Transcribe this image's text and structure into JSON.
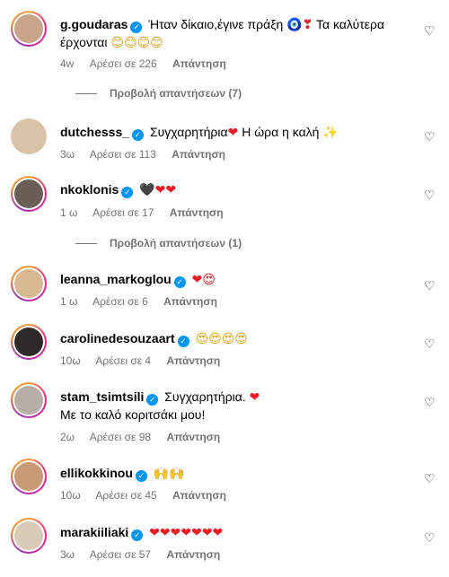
{
  "comments": [
    {
      "username": "g.goudaras",
      "text": "Ήταν δίκαιο,έγινε πράξη",
      "emojis_line1": "🧿❣",
      "text2": "Τα καλύτερα",
      "line2": "έρχονται",
      "emojis_line2": "😊😊😊😊",
      "time": "4w",
      "likes": "Αρέσει σε 226",
      "reply": "Απάντηση",
      "view_replies": "Προβολή απαντήσεων (7)",
      "avatar_color": "#c9a489",
      "ring": true
    },
    {
      "username": "dutchesss_",
      "text": "Συγχαρητήρια",
      "text_after": "Η ώρα η καλή",
      "emoji_mid": "❤",
      "emoji_end": "✨",
      "time": "3ω",
      "likes": "Αρέσει σε 113",
      "reply": "Απάντηση",
      "avatar_color": "#d8c2a8",
      "ring": false
    },
    {
      "username": "nkoklonis",
      "emojis": "🖤❤❤",
      "time": "1 ω",
      "likes": "Αρέσει σε 17",
      "reply": "Απάντηση",
      "view_replies": "Προβολή απαντήσεων (1)",
      "avatar_color": "#6b5e57",
      "ring": true
    },
    {
      "username": "leanna_markoglou",
      "emojis": "❤😍",
      "time": "1 ω",
      "likes": "Αρέσει σε 6",
      "reply": "Απάντηση",
      "avatar_color": "#d7b891",
      "ring": true
    },
    {
      "username": "carolinedesouzaart",
      "emojis": "😍😍😍😍",
      "time": "10ω",
      "likes": "Αρέσει σε 4",
      "reply": "Απάντηση",
      "avatar_color": "#2e2a28",
      "ring": true
    },
    {
      "username": "stam_tsimtsili",
      "text": "Συγχαρητήρια.",
      "emoji_end": "❤",
      "line2": "Με το καλό κοριτσάκι μου!",
      "time": "2ω",
      "likes": "Αρέσει σε 98",
      "reply": "Απάντηση",
      "avatar_color": "#b7aea6",
      "ring": true
    },
    {
      "username": "ellikokkinou",
      "emojis": "🙌🙌",
      "time": "10ω",
      "likes": "Αρέσει σε 45",
      "reply": "Απάντηση",
      "avatar_color": "#c99a73",
      "ring": true
    },
    {
      "username": "marakiiliaki",
      "emojis": "❤❤❤❤❤❤❤",
      "time": "3ω",
      "likes": "Αρέσει σε 57",
      "reply": "Απάντηση",
      "avatar_color": "#d9cbb8",
      "ring": true
    }
  ],
  "colors": {
    "verified": "#0095f6",
    "meta": "#737373",
    "heart_red": "#ed1c24"
  },
  "icons": {
    "verified": "verified-badge-icon",
    "like": "heart-outline-icon"
  }
}
